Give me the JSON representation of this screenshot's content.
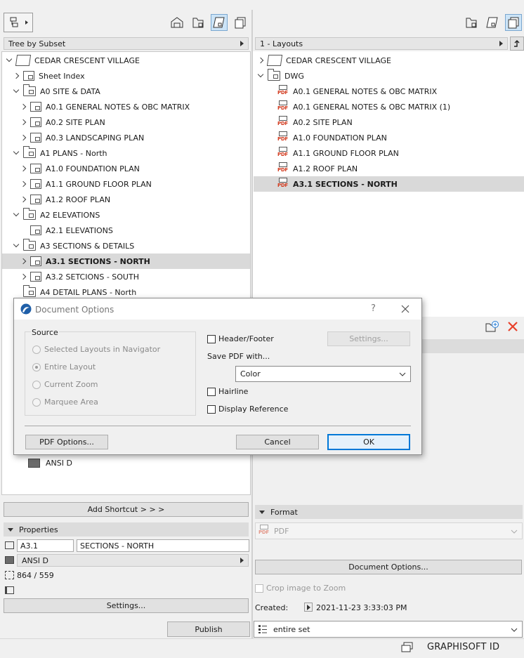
{
  "left": {
    "tree_mode": "Tree by Subset",
    "tree": [
      {
        "label": "CEDAR CRESCENT VILLAGE",
        "level": 0,
        "chevron": "down",
        "icon": "book-icon"
      },
      {
        "label": "Sheet Index",
        "level": 1,
        "chevron": "right",
        "icon": "sheet-icon"
      },
      {
        "label": "A0 SITE & DATA",
        "level": 1,
        "chevron": "down",
        "icon": "folder-icon"
      },
      {
        "label": "A0.1 GENERAL NOTES & OBC MATRIX",
        "level": 2,
        "chevron": "right",
        "icon": "sheet-icon"
      },
      {
        "label": "A0.2  SITE PLAN",
        "level": 2,
        "chevron": "right",
        "icon": "sheet-icon"
      },
      {
        "label": "A0.3 LANDSCAPING PLAN",
        "level": 2,
        "chevron": "right",
        "icon": "sheet-icon"
      },
      {
        "label": "A1 PLANS - North",
        "level": 1,
        "chevron": "down",
        "icon": "folder-icon"
      },
      {
        "label": "A1.0 FOUNDATION PLAN",
        "level": 2,
        "chevron": "right",
        "icon": "sheet-icon"
      },
      {
        "label": "A1.1 GROUND FLOOR PLAN",
        "level": 2,
        "chevron": "right",
        "icon": "sheet-icon"
      },
      {
        "label": "A1.2 ROOF PLAN",
        "level": 2,
        "chevron": "right",
        "icon": "sheet-icon"
      },
      {
        "label": "A2 ELEVATIONS",
        "level": 1,
        "chevron": "down",
        "icon": "folder-icon"
      },
      {
        "label": "A2.1 ELEVATIONS",
        "level": 2,
        "chevron": "none",
        "icon": "sheet-icon"
      },
      {
        "label": "A3 SECTIONS & DETAILS",
        "level": 1,
        "chevron": "down",
        "icon": "folder-icon"
      },
      {
        "label": "A3.1 SECTIONS - NORTH",
        "level": 2,
        "chevron": "right",
        "icon": "sheet-icon",
        "selected": true
      },
      {
        "label": "A3.2 SETCIONS - SOUTH",
        "level": 2,
        "chevron": "right",
        "icon": "sheet-icon"
      },
      {
        "label": "A4 DETAIL PLANS - North",
        "level": 1,
        "chevron": "none",
        "icon": "folder-icon"
      }
    ],
    "bottom_item": "ANSI D",
    "add_shortcut": "Add Shortcut > > >",
    "properties_label": "Properties",
    "prop_id": "A3.1",
    "prop_name": "SECTIONS - NORTH",
    "prop_master": "ANSI D",
    "prop_size": "864 / 559",
    "settings_label": "Settings...",
    "publish_label": "Publish"
  },
  "right": {
    "set_combo": "1 - Layouts",
    "tree": [
      {
        "label": "CEDAR CRESCENT VILLAGE",
        "chevron": "right",
        "icon": "book-icon",
        "indent": 0
      },
      {
        "label": "DWG",
        "chevron": "down",
        "icon": "folder-icon",
        "indent": 0
      },
      {
        "label": "A0.1 GENERAL NOTES & OBC MATRIX",
        "chevron": "none",
        "icon": "pdf-icon",
        "indent": 1
      },
      {
        "label": "A0.1 GENERAL NOTES & OBC MATRIX (1)",
        "chevron": "none",
        "icon": "pdf-icon",
        "indent": 1
      },
      {
        "label": "A0.2  SITE PLAN",
        "chevron": "none",
        "icon": "pdf-icon",
        "indent": 1
      },
      {
        "label": "A1.0 FOUNDATION PLAN",
        "chevron": "none",
        "icon": "pdf-icon",
        "indent": 1
      },
      {
        "label": "A1.1 GROUND FLOOR PLAN",
        "chevron": "none",
        "icon": "pdf-icon",
        "indent": 1
      },
      {
        "label": "A1.2 ROOF PLAN",
        "chevron": "none",
        "icon": "pdf-icon",
        "indent": 1
      },
      {
        "label": "A3.1 SECTIONS - NORTH",
        "chevron": "none",
        "icon": "pdf-icon",
        "indent": 1,
        "selected": true
      }
    ],
    "format_label": "Format",
    "format_value": "PDF",
    "doc_options_label": "Document Options...",
    "crop_label": "Crop image to Zoom",
    "created_label": "Created:",
    "created_value": "2021-11-23 3:33:03 PM",
    "set_value": "entire set",
    "brand": "GRAPHISOFT ID"
  },
  "dialog": {
    "title": "Document Options",
    "help": "?",
    "source_label": "Source",
    "radios": [
      "Selected Layouts in Navigator",
      "Entire Layout",
      "Current Zoom",
      "Marquee Area"
    ],
    "header_footer": "Header/Footer",
    "settings": "Settings...",
    "save_pdf_with": "Save PDF with...",
    "color_value": "Color",
    "hairline": "Hairline",
    "display_reference": "Display Reference",
    "pdf_options": "PDF Options...",
    "cancel": "Cancel",
    "ok": "OK"
  },
  "colors": {
    "selection": "#d9d9d9",
    "accent": "#0078d7",
    "delete": "#e8412b"
  }
}
